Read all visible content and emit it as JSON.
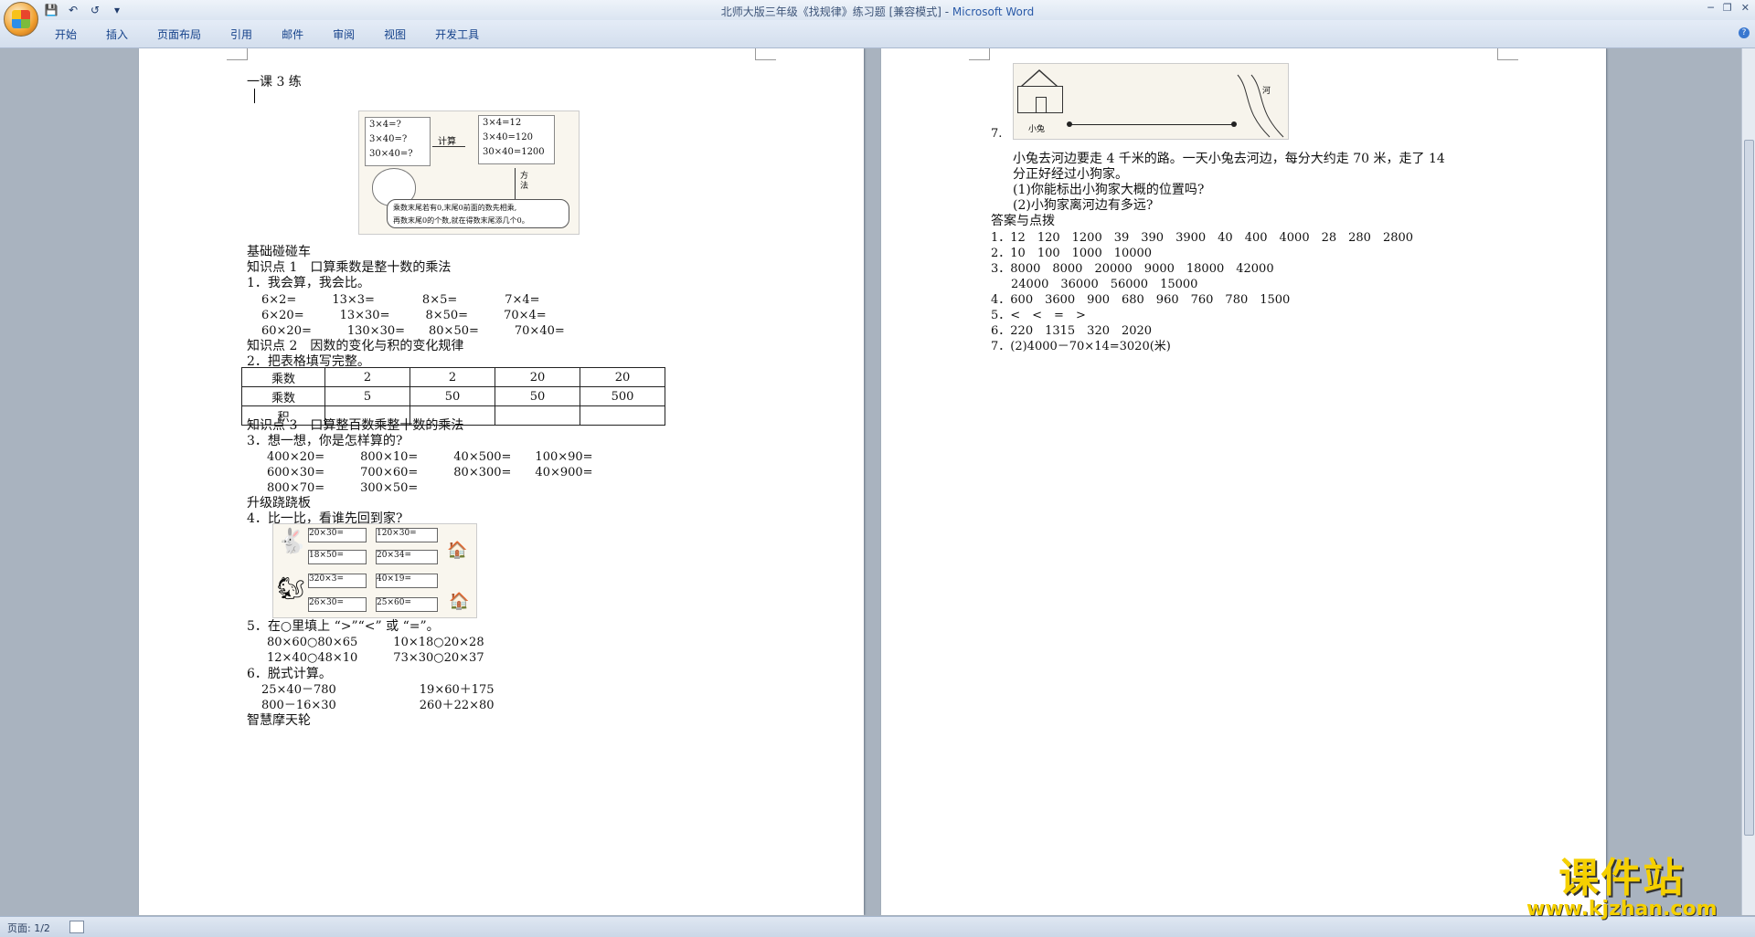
{
  "window": {
    "title": "北师大版三年级《找规律》练习题 [兼容模式] - ",
    "app_name": "Microsoft Word"
  },
  "qat": {
    "save_icon": "💾",
    "undo_icon": "↶",
    "redo_icon": "↺",
    "more_icon": "▾"
  },
  "ribbon": {
    "tabs": [
      "开始",
      "插入",
      "页面布局",
      "引用",
      "邮件",
      "审阅",
      "视图",
      "开发工具"
    ]
  },
  "left_page": {
    "lines": [
      "一课 3 练",
      "基础碰碰车",
      "知识点 1　口算乘数是整十数的乘法",
      "1．我会算，我会比。",
      "6×2=　　　13×3=　　　　8×5=　　　　7×4=",
      "6×20=　　　13×30=　　　8×50=　　　70×4=",
      "60×20=　　　130×30=　　80×50=　　　70×40=",
      "知识点 2　因数的变化与积的变化规律",
      "2．把表格填写完整。",
      "知识点 3　口算整百数乘整十数的乘法",
      "3．想一想，你是怎样算的?",
      "400×20=　　　800×10=　　　40×500=　　100×90=",
      "600×30=　　　700×60=　　　80×300=　　40×900=",
      "800×70=　　　300×50=",
      "升级跷跷板",
      "4．比一比，看谁先回到家?",
      "5．在○里填上 “>”“<” 或 “=”。",
      "80×60○80×65　　　10×18○20×28",
      "12×40○48×10　　　73×30○20×37",
      "6．脱式计算。",
      "25×40－780　　　　　　　19×60＋175",
      "800－16×30　　　　　　　260＋22×80",
      "智慧摩天轮"
    ],
    "table": {
      "rows": [
        [
          "乘数",
          "2",
          "2",
          "20",
          "20"
        ],
        [
          "乘数",
          "5",
          "50",
          "50",
          "500"
        ],
        [
          "积",
          "",
          "",
          "",
          ""
        ]
      ]
    },
    "figure1": {
      "left_lines": [
        "3×4=?",
        "3×40=?",
        "30×40=?"
      ],
      "arrow_label": "计算",
      "right_lines": [
        "3×4=12",
        "3×40=120",
        "30×40=1200"
      ],
      "down_label": "方法",
      "bubble_lines": [
        "乘数末尾若有0,末尾0前面的数先相乘,",
        "再数末尾0的个数,就在得数末尾添几个0。"
      ]
    },
    "figure4": {
      "boxes": [
        "20×30=",
        "120×30=",
        "18×50=",
        "20×34=",
        "320×3=",
        "40×19=",
        "26×30=",
        "25×60="
      ]
    }
  },
  "right_page": {
    "fig_labels": {
      "house": "小兔",
      "river": "河"
    },
    "q7_num": "7.",
    "lines": [
      "小兔去河边要走 4 千米的路。一天小兔去河边，每分大约走 70 米，走了 14",
      "分正好经过小狗家。",
      "(1)你能标出小狗家大概的位置吗?",
      "(2)小狗家离河边有多远?",
      "答案与点拨",
      "1．12　120　1200　39　390　3900　40　400　4000　28　280　2800",
      "2．10　100　1000　10000",
      "3．8000　8000　20000　9000　18000　42000",
      "24000　36000　56000　15000",
      "4．600　3600　900　680　960　760　780　1500",
      "5．<　<　=　>",
      "6．220　1315　320　2020",
      "7．(2)4000－70×14=3020(米)"
    ]
  },
  "status": {
    "page_info": "页面: 1/2"
  },
  "watermark": {
    "title": "课件站",
    "url": "www.kjzhan.com"
  }
}
